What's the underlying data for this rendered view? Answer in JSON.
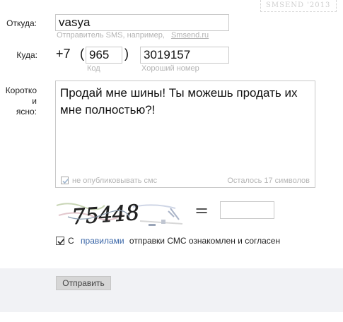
{
  "stamp": {
    "text": "SMSEND  '2013"
  },
  "from": {
    "label": "Откуда:",
    "value": "vasya",
    "hint": "Отправитель SMS, например,",
    "hint_link": "Smsend.ru"
  },
  "to": {
    "label": "Куда:",
    "prefix": "+7",
    "open_paren": "(",
    "close_paren": ")",
    "code_value": "965",
    "code_hint": "Код",
    "number_value": "3019157",
    "number_hint": "Хороший номер"
  },
  "message": {
    "label_line1": "Коротко и",
    "label_line2": "ясно:",
    "text": "Продай мне шины! Ты можешь продать их мне полностью?!",
    "no_publish_label": "не опубликовывать смс",
    "no_publish_checked": true,
    "remaining": "Осталось 17 символов"
  },
  "captcha": {
    "image_text": "75448",
    "equals": "="
  },
  "agree": {
    "checked": true,
    "prefix": "С",
    "link": "правилами",
    "suffix": "отправки СМС ознакомлен и согласен"
  },
  "submit": {
    "label": "Отправить"
  },
  "colors": {
    "link": "#3b67a8",
    "footer_bg": "#f1f2f5",
    "border": "#c9c9c9"
  }
}
